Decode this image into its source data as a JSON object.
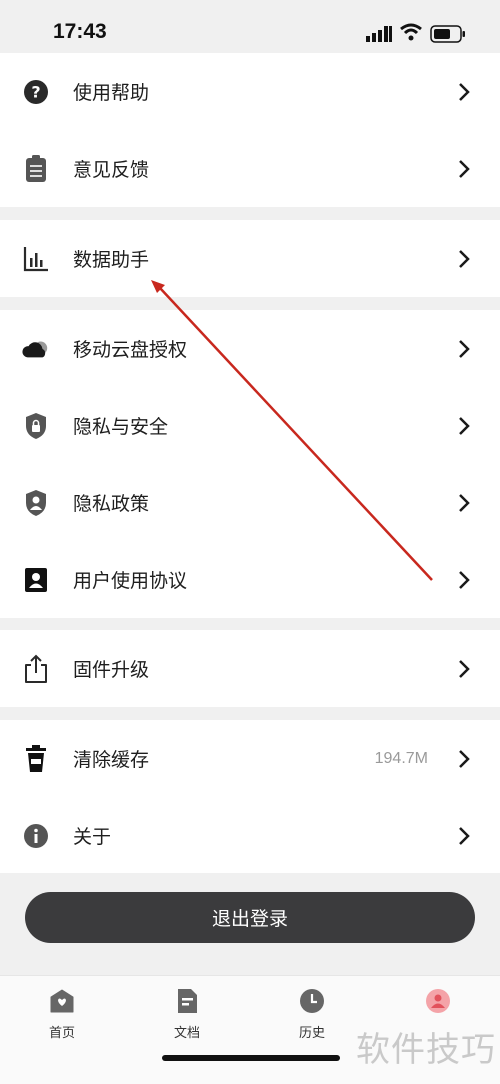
{
  "status_bar": {
    "time": "17:43"
  },
  "menu_groups": [
    {
      "items": [
        {
          "label": "使用帮助",
          "icon": "help-circle-icon"
        },
        {
          "label": "意见反馈",
          "icon": "clipboard-icon"
        }
      ]
    },
    {
      "items": [
        {
          "label": "数据助手",
          "icon": "bar-chart-icon"
        }
      ]
    },
    {
      "items": [
        {
          "label": "移动云盘授权",
          "icon": "cloud-icon"
        },
        {
          "label": "隐私与安全",
          "icon": "shield-lock-icon"
        },
        {
          "label": "隐私政策",
          "icon": "shield-user-icon"
        },
        {
          "label": "用户使用协议",
          "icon": "user-card-icon"
        }
      ]
    },
    {
      "items": [
        {
          "label": "固件升级",
          "icon": "share-upload-icon"
        }
      ]
    },
    {
      "items": [
        {
          "label": "清除缓存",
          "icon": "trash-cup-icon",
          "value": "194.7M"
        },
        {
          "label": "关于",
          "icon": "info-circle-icon"
        }
      ]
    }
  ],
  "logout": {
    "label": "退出登录"
  },
  "tabbar": {
    "tabs": [
      {
        "label": "首页",
        "icon": "home-icon"
      },
      {
        "label": "文档",
        "icon": "document-icon"
      },
      {
        "label": "历史",
        "icon": "clock-icon"
      },
      {
        "label": "",
        "icon": "profile-icon",
        "active": true
      }
    ]
  },
  "watermark": "软件技巧",
  "colors": {
    "annotation_arrow": "#c8281e",
    "logout_bg": "#3b3b3d",
    "active_tab": "#e2525c"
  }
}
